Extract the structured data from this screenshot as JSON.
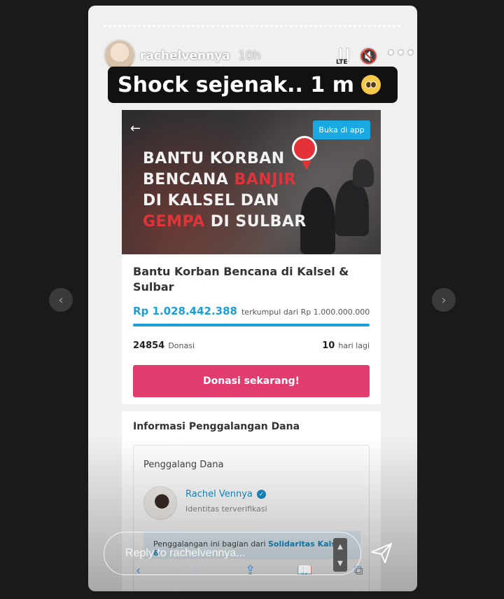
{
  "story": {
    "username": "rachelvennya",
    "time_ago": "10h",
    "network": "LTE",
    "caption": "Shock sejenak.. 1 m",
    "reply_placeholder": "Reply to rachelvennya..."
  },
  "campaign": {
    "open_app_label": "Buka di app",
    "banner_lines": [
      {
        "pre": "BANTU KORBAN",
        "hl": "",
        "post": ""
      },
      {
        "pre": "BENCANA ",
        "hl": "BANJIR",
        "post": ""
      },
      {
        "pre": "DI KALSEL DAN",
        "hl": "",
        "post": ""
      },
      {
        "pre": "",
        "hl": "GEMPA",
        "post": " DI SULBAR"
      }
    ],
    "title": "Bantu Korban Bencana di Kalsel & Sulbar",
    "amount": "Rp 1.028.442.388",
    "collected_text": "terkumpul dari Rp 1.000.000.000",
    "progress_fraction": 1.0,
    "donors_count": "24854",
    "donors_label": "Donasi",
    "days_count": "10",
    "days_label": "hari lagi",
    "donate_button": "Donasi sekarang!"
  },
  "info": {
    "section_title": "Informasi Penggalangan Dana",
    "fundraiser_label": "Penggalang Dana",
    "fundraiser_name": "Rachel Vennya",
    "verified_status": "Identitas terverifikasi",
    "note_text": "Penggalangan ini bagian dari ",
    "note_link": "Solidaritas Kalsel &"
  },
  "colors": {
    "accent_blue": "#19a0d9",
    "donate_pink": "#e23c6f",
    "banner_red": "#e0343a"
  }
}
